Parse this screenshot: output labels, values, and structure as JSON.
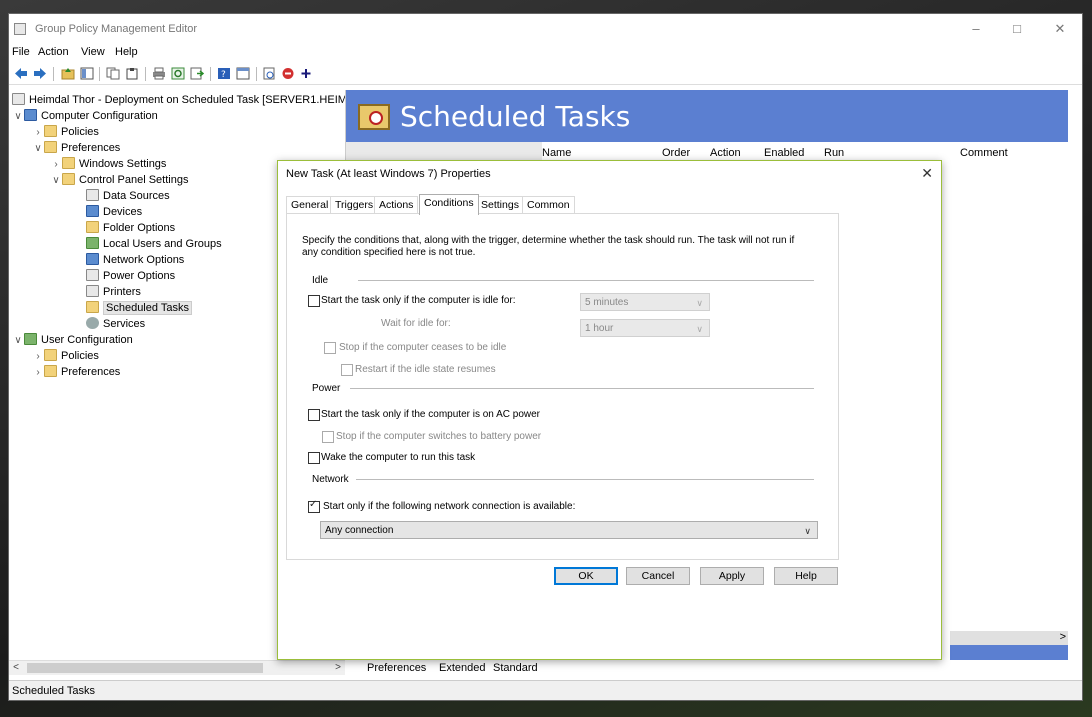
{
  "window": {
    "title": "Group Policy Management Editor",
    "controls": {
      "minimize": "–",
      "maximize": "□",
      "close": "✕"
    }
  },
  "menu": [
    "File",
    "Action",
    "View",
    "Help"
  ],
  "toolbar": {
    "icons": [
      "back-arrow-icon",
      "forward-arrow-icon",
      "up-folder-icon",
      "show-hide-tree-icon",
      "copy-icon",
      "paste-icon",
      "print-icon",
      "refresh-icon",
      "export-icon",
      "help-icon",
      "properties-icon",
      "preview-icon",
      "stop-icon",
      "add-icon"
    ]
  },
  "tree": {
    "root": "Heimdal Thor - Deployment on Scheduled Task [SERVER1.HEIMD",
    "computer_config": "Computer Configuration",
    "cc_policies": "Policies",
    "cc_preferences": "Preferences",
    "windows_settings": "Windows Settings",
    "control_panel_settings": "Control Panel Settings",
    "cp_items": [
      "Data Sources",
      "Devices",
      "Folder Options",
      "Local Users and Groups",
      "Network Options",
      "Power Options",
      "Printers",
      "Scheduled Tasks",
      "Services"
    ],
    "user_config": "User Configuration",
    "uc_policies": "Policies",
    "uc_preferences": "Preferences"
  },
  "right_pane": {
    "banner_title": "Scheduled Tasks",
    "columns": [
      "Name",
      "Order",
      "Action",
      "Enabled",
      "Run",
      "Comment"
    ]
  },
  "bottom_tabs": [
    "Preferences",
    "Extended",
    "Standard"
  ],
  "status_text": "Scheduled Tasks",
  "dialog": {
    "title": "New Task (At least Windows 7) Properties",
    "close": "✕",
    "tabs": [
      "General",
      "Triggers",
      "Actions",
      "Conditions",
      "Settings",
      "Common"
    ],
    "active_tab": "Conditions",
    "description": "Specify the conditions that, along with the trigger, determine whether the task should run. The task will not run if any condition specified here is not true.",
    "idle": {
      "group": "Idle",
      "start_if_idle": "Start the task only if the computer is idle for:",
      "idle_duration": "5 minutes",
      "wait_label": "Wait for idle for:",
      "wait_duration": "1 hour",
      "stop_if_not_idle": "Stop if the computer ceases to be idle",
      "restart_if_idle": "Restart if the idle state resumes"
    },
    "power": {
      "group": "Power",
      "ac_power": "Start the task only if the computer is on AC power",
      "battery_stop": "Stop if the computer switches to battery power",
      "wake": "Wake the computer to run this task"
    },
    "network": {
      "group": "Network",
      "start_if_network": "Start only if the following network connection is available:",
      "network_checked": true,
      "connection": "Any connection"
    },
    "buttons": {
      "ok": "OK",
      "cancel": "Cancel",
      "apply": "Apply",
      "help": "Help"
    }
  },
  "colors": {
    "banner": "#5b7fd1",
    "dialog_border": "#9bbe3a",
    "accent": "#0078d7"
  }
}
